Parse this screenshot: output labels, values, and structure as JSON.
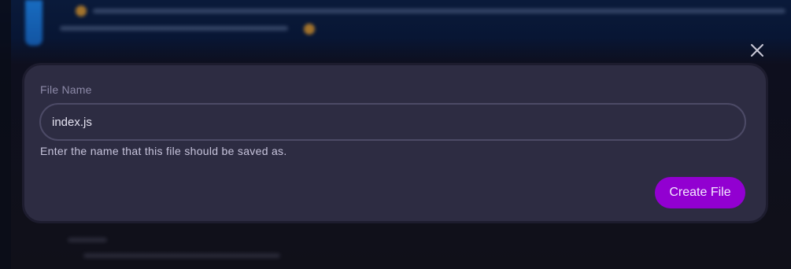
{
  "dialog": {
    "close_icon": "close-icon",
    "field_label": "File Name",
    "file_name_value": "index.js",
    "help_text": "Enter the name that this file should be saved as.",
    "create_button_label": "Create File"
  },
  "colors": {
    "accent": "#9200d1",
    "modal_background": "#2d2c42",
    "input_border": "#4c4a66"
  }
}
